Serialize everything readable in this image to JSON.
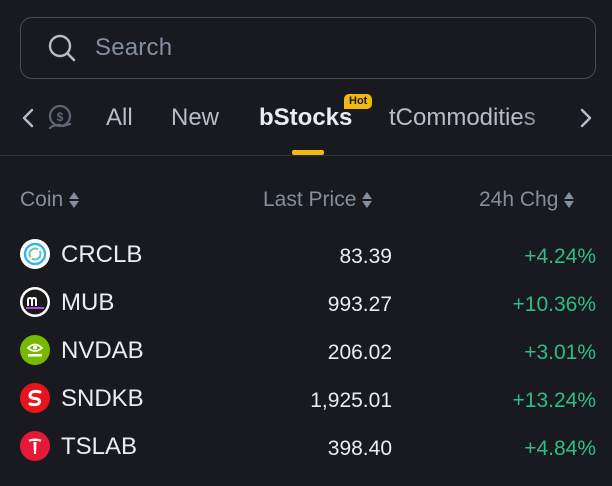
{
  "search": {
    "placeholder": "Search",
    "icon": "search-icon"
  },
  "tabs": {
    "items": [
      {
        "label": "All"
      },
      {
        "label": "New"
      },
      {
        "label": "bStocks",
        "active": true,
        "badge": "Hot"
      },
      {
        "label": "tCommodities"
      }
    ],
    "accent": "#f0b90b"
  },
  "table": {
    "headers": {
      "coin": "Coin",
      "price": "Last Price",
      "change": "24h Chg"
    },
    "rows": [
      {
        "coin": "CRCLB",
        "price": "83.39",
        "change": "+4.24%",
        "logo": "circle-logo"
      },
      {
        "coin": "MUB",
        "price": "993.27",
        "change": "+10.36%",
        "logo": "micron-logo"
      },
      {
        "coin": "NVDAB",
        "price": "206.02",
        "change": "+3.01%",
        "logo": "nvidia-logo"
      },
      {
        "coin": "SNDKB",
        "price": "1,925.01",
        "change": "+13.24%",
        "logo": "sandisk-logo"
      },
      {
        "coin": "TSLAB",
        "price": "398.40",
        "change": "+4.84%",
        "logo": "tesla-logo"
      }
    ],
    "positive_color": "#2ebd85"
  }
}
